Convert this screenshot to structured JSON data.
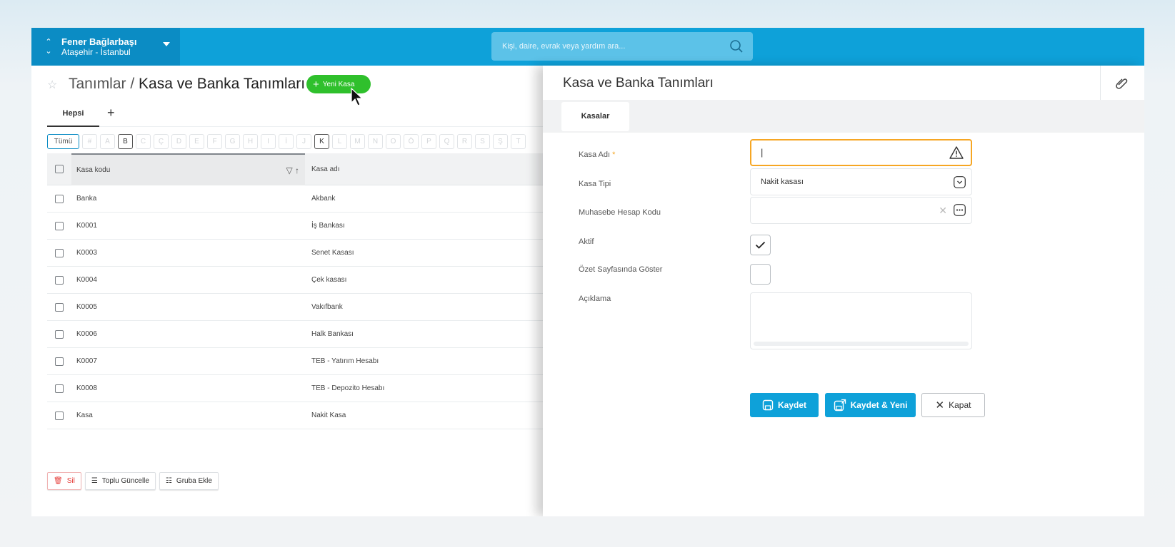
{
  "org": {
    "name": "Fener Bağlarbaşı",
    "location": "Ataşehir - İstanbul"
  },
  "search": {
    "placeholder": "Kişi, daire, evrak veya yardım ara..."
  },
  "breadcrumb": {
    "parent": "Tanımlar / ",
    "current": "Kasa ve Banka Tanımları"
  },
  "new_button": "Yeni Kasa",
  "subtabs": {
    "all": "Hepsi",
    "add": "+"
  },
  "alphabet": [
    "Tümü",
    "#",
    "A",
    "B",
    "C",
    "Ç",
    "D",
    "E",
    "F",
    "G",
    "H",
    "I",
    "İ",
    "J",
    "K",
    "L",
    "M",
    "N",
    "O",
    "Ö",
    "P",
    "Q",
    "R",
    "S",
    "Ş",
    "T"
  ],
  "alphabet_active": [
    "B",
    "K"
  ],
  "table": {
    "columns": [
      "Kasa kodu",
      "Kasa adı"
    ],
    "rows": [
      [
        "Banka",
        "Akbank"
      ],
      [
        "K0001",
        "İş Bankası"
      ],
      [
        "K0003",
        "Senet Kasası"
      ],
      [
        "K0004",
        "Çek kasası"
      ],
      [
        "K0005",
        "Vakıfbank"
      ],
      [
        "K0006",
        "Halk Bankası"
      ],
      [
        "K0007",
        "TEB - Yatırım Hesabı"
      ],
      [
        "K0008",
        "TEB - Depozito Hesabı"
      ],
      [
        "Kasa",
        "Nakit Kasa"
      ]
    ]
  },
  "bulk_actions": {
    "delete": "Sil",
    "bulk_update": "Toplu Güncelle",
    "add_group": "Gruba Ekle"
  },
  "panel": {
    "title": "Kasa ve Banka Tanımları",
    "tab": "Kasalar",
    "labels": {
      "name": "Kasa Adı",
      "required_mark": "*",
      "type": "Kasa Tipi",
      "account_code": "Muhasebe Hesap Kodu",
      "active": "Aktif",
      "show_summary": "Özet Sayfasında Göster",
      "description": "Açıklama"
    },
    "values": {
      "name": "|",
      "type": "Nakit kasası",
      "account_code": "",
      "active": true,
      "show_summary": false,
      "description": ""
    },
    "buttons": {
      "save": "Kaydet",
      "save_new": "Kaydet & Yeni",
      "close": "Kapat"
    }
  },
  "colors": {
    "brand": "#0ea1d9",
    "brand_dark": "#0b8cc4",
    "success": "#2fc02c",
    "warning": "#f6a623",
    "danger": "#e53935"
  }
}
